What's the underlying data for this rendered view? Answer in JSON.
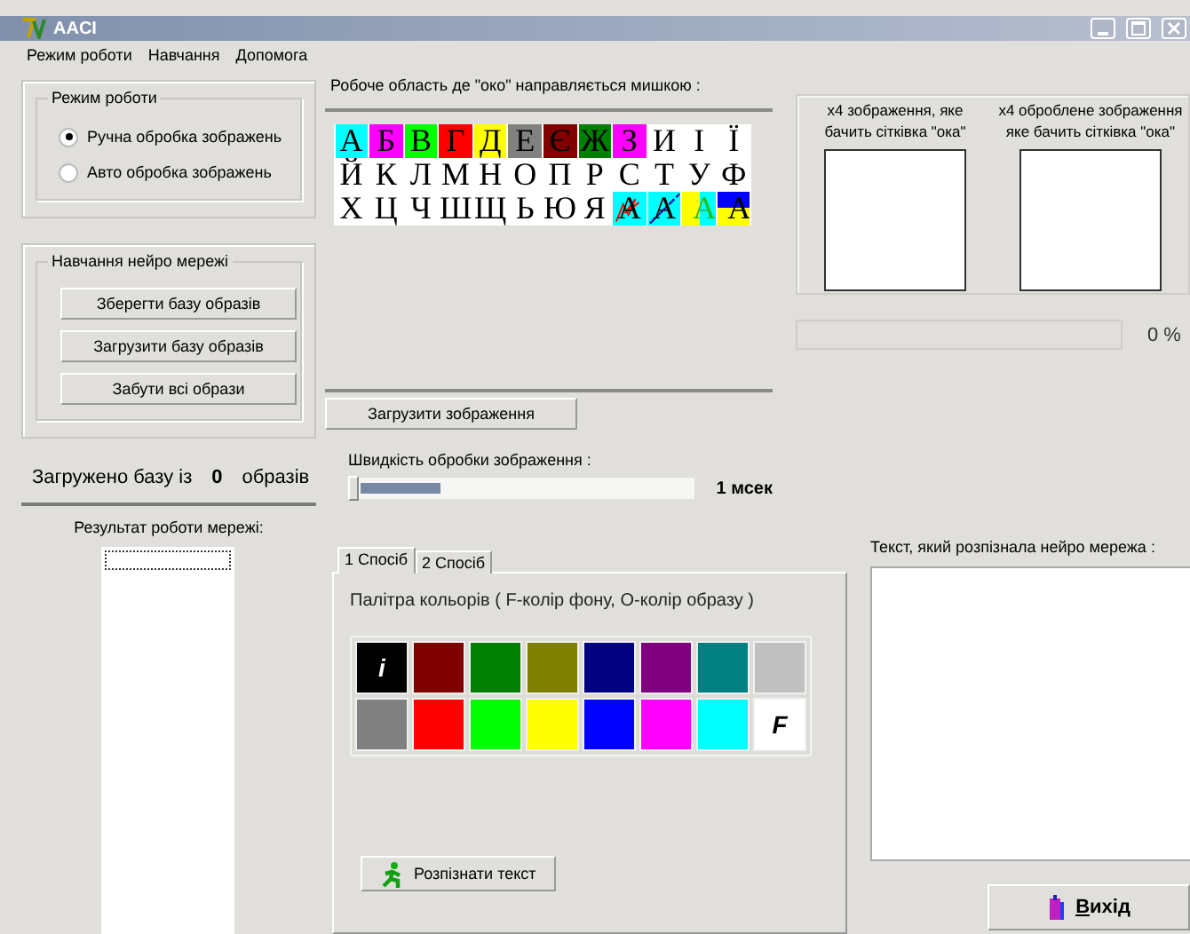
{
  "window": {
    "title": "AACI"
  },
  "menu": [
    "Режим роботи",
    "Навчання",
    "Допомога"
  ],
  "mode_group": {
    "title": "Режим роботи",
    "options": [
      {
        "label": "Ручна обробка зображень",
        "selected": true
      },
      {
        "label": "Авто обробка зображень",
        "selected": false
      }
    ]
  },
  "training_group": {
    "title": "Навчання нейро мережі",
    "buttons": [
      "Зберегти базу образів",
      "Загрузити базу образів",
      "Забути всі образи"
    ]
  },
  "loaded": {
    "prefix": "Загружено базу із",
    "count": "0",
    "suffix": "образів"
  },
  "result": {
    "label": "Результат роботи мережі:"
  },
  "work_area": {
    "label": "Робоче область де \"око\" направляється мишкою :",
    "letters": [
      {
        "char": "А",
        "color": "#00ffff",
        "kind": "plain"
      },
      {
        "char": "Б",
        "color": "#ff00ff",
        "kind": "plain"
      },
      {
        "char": "В",
        "color": "#00ff00",
        "kind": "plain"
      },
      {
        "char": "Г",
        "color": "#ff0000",
        "kind": "plain"
      },
      {
        "char": "Д",
        "color": "#ffff00",
        "kind": "plain"
      },
      {
        "char": "Е",
        "color": "#808080",
        "kind": "plain"
      },
      {
        "char": "Є",
        "color": "#800000",
        "kind": "plain"
      },
      {
        "char": "Ж",
        "color": "#008000",
        "kind": "plain"
      },
      {
        "char": "З",
        "color": "#ff00ff",
        "kind": "plain"
      },
      {
        "char": "И",
        "color": "#ffffff",
        "kind": "plain"
      },
      {
        "char": "І",
        "color": "#ffffff",
        "kind": "plain"
      },
      {
        "char": "Ї",
        "color": "#ffffff",
        "kind": "plain"
      },
      {
        "char": "Й",
        "color": "#ffffff",
        "kind": "plain"
      },
      {
        "char": "К",
        "color": "#ffffff",
        "kind": "plain"
      },
      {
        "char": "Л",
        "color": "#ffffff",
        "kind": "plain"
      },
      {
        "char": "М",
        "color": "#ffffff",
        "kind": "plain"
      },
      {
        "char": "Н",
        "color": "#ffffff",
        "kind": "plain"
      },
      {
        "char": "О",
        "color": "#ffffff",
        "kind": "plain"
      },
      {
        "char": "П",
        "color": "#ffffff",
        "kind": "plain"
      },
      {
        "char": "Р",
        "color": "#ffffff",
        "kind": "plain"
      },
      {
        "char": "С",
        "color": "#ffffff",
        "kind": "plain"
      },
      {
        "char": "Т",
        "color": "#ffffff",
        "kind": "plain"
      },
      {
        "char": "У",
        "color": "#ffffff",
        "kind": "plain"
      },
      {
        "char": "Ф",
        "color": "#ffffff",
        "kind": "plain"
      },
      {
        "char": "Х",
        "color": "#ffffff",
        "kind": "plain"
      },
      {
        "char": "Ц",
        "color": "#ffffff",
        "kind": "plain"
      },
      {
        "char": "Ч",
        "color": "#ffffff",
        "kind": "plain"
      },
      {
        "char": "Ш",
        "color": "#ffffff",
        "kind": "plain"
      },
      {
        "char": "Щ",
        "color": "#ffffff",
        "kind": "plain"
      },
      {
        "char": "Ь",
        "color": "#ffffff",
        "kind": "plain"
      },
      {
        "char": "Ю",
        "color": "#ffffff",
        "kind": "plain"
      },
      {
        "char": "Я",
        "color": "#ffffff",
        "kind": "plain"
      },
      {
        "char": "А",
        "color": "#00ffff",
        "kind": "scribble"
      },
      {
        "char": "А",
        "color": "#00ffff",
        "kind": "dots"
      },
      {
        "char": "А",
        "kind": "split_v",
        "bands": [
          {
            "color": "#ffff00"
          },
          {
            "color": "#00ffff"
          }
        ]
      },
      {
        "char": "А",
        "kind": "split_h",
        "bands": [
          {
            "color": "#0000ff"
          },
          {
            "color": "#ffff00"
          }
        ]
      }
    ]
  },
  "load_image_button": "Загрузити зображення",
  "speed": {
    "label": "Швидкість обробки зображення :",
    "level": 0,
    "reading": "1 мсек"
  },
  "previews": [
    {
      "caption_lines": [
        "x4 зображення, яке",
        "бачить сітківка \"ока\""
      ]
    },
    {
      "caption_lines": [
        "x4 оброблене зображення",
        "яке бачить сітківка \"ока\""
      ]
    }
  ],
  "progress": {
    "level": 0,
    "reading": "0 %"
  },
  "tabs": [
    {
      "label": "1 Спосіб",
      "selected": true
    },
    {
      "label": "2 Спосіб",
      "selected": false
    }
  ],
  "palette": {
    "label": "Палітра кольорів ( F-колір фону, O-колір образу )",
    "colors": [
      {
        "color": "#000000",
        "marker": "i"
      },
      {
        "color": "#800000"
      },
      {
        "color": "#008000"
      },
      {
        "color": "#808000"
      },
      {
        "color": "#000080"
      },
      {
        "color": "#800080"
      },
      {
        "color": "#008080"
      },
      {
        "color": "#c0c0c0"
      },
      {
        "color": "#808080"
      },
      {
        "color": "#ff0000"
      },
      {
        "color": "#00ff00"
      },
      {
        "color": "#ffff00"
      },
      {
        "color": "#0000ff"
      },
      {
        "color": "#ff00ff"
      },
      {
        "color": "#00ffff"
      },
      {
        "color": "#ffffff",
        "marker": "F"
      }
    ]
  },
  "recognize_button": "Розпізнати текст",
  "recognized": {
    "label": "Текст, який розпізнала нейро мережа :"
  },
  "exit_button": "Вихід"
}
